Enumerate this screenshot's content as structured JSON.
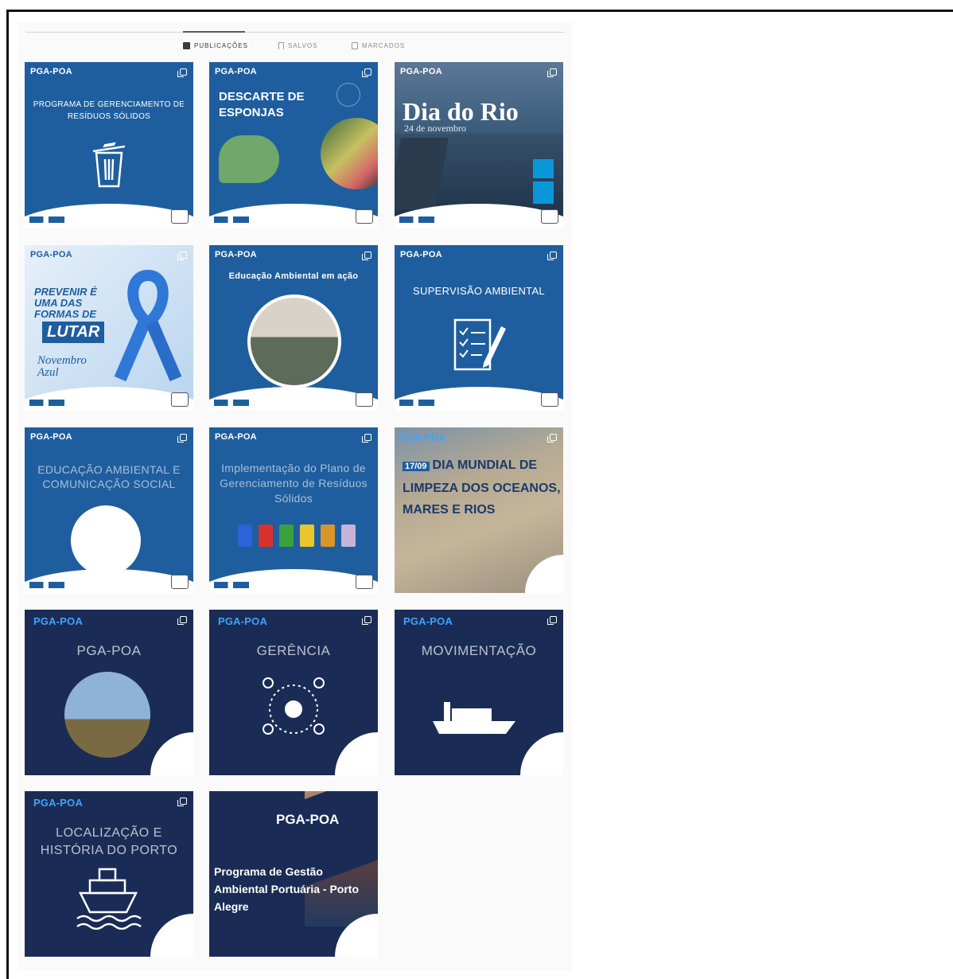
{
  "tabs": [
    {
      "label": "PUBLICAÇÕES",
      "icon": "grid-icon",
      "active": true
    },
    {
      "label": "SALVOS",
      "icon": "bookmark-icon",
      "active": false
    },
    {
      "label": "MARCADOS",
      "icon": "tag-icon",
      "active": false
    }
  ],
  "brand": "PGA-POA",
  "posts": {
    "p1": {
      "title": "PROGRAMA DE GERENCIAMENTO DE RESÍDUOS SÓLIDOS",
      "icon": "trash-icon"
    },
    "p2": {
      "title": "DESCARTE DE ESPONJAS"
    },
    "p3": {
      "title": "Dia do Rio",
      "subtitle": "24 de novembro"
    },
    "p4": {
      "line1": "PREVENIR É UMA DAS FORMAS DE",
      "line2": "LUTAR",
      "line3": "Novembro Azul",
      "icon": "ribbon-icon"
    },
    "p5": {
      "title": "Educação Ambiental em ação"
    },
    "p6": {
      "title": "SUPERVISÃO AMBIENTAL",
      "icon": "checklist-icon"
    },
    "p7": {
      "title": "EDUCAÇÃO AMBIENTAL E COMUNICAÇÃO SOCIAL"
    },
    "p8": {
      "title": "Implementação do Plano de Gerenciamento de Resíduos Sólidos"
    },
    "p9": {
      "date": "17/09",
      "title": "DIA MUNDIAL DE LIMPEZA DOS OCEANOS, MARES E RIOS"
    },
    "p10": {
      "title": "PGA-POA"
    },
    "p11": {
      "title": "GERÊNCIA",
      "icon": "gear-team-icon"
    },
    "p12": {
      "title": "MOVIMENTAÇÃO",
      "icon": "cargo-ship-icon"
    },
    "p13": {
      "title": "LOCALIZAÇÃO E HISTÓRIA DO PORTO",
      "icon": "ship-icon"
    },
    "p14": {
      "title": "Programa de Gestão Ambiental Portuária - Porto Alegre"
    }
  },
  "colors": {
    "blue": "#1f5e9e",
    "navy": "#1a2c55",
    "accent": "#3ea3ff"
  }
}
